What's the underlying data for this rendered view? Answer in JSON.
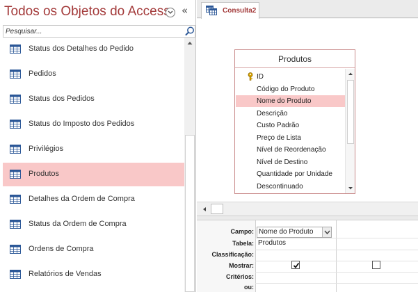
{
  "nav": {
    "title": "Todos os Objetos do Access",
    "dropdown_icon": "chevron-down-circle-icon",
    "collapse_glyph": "«",
    "search_placeholder": "Pesquisar...",
    "items": [
      {
        "label": "Status dos Detalhes do Pedido",
        "icon": "table-icon",
        "selected": false
      },
      {
        "label": "Pedidos",
        "icon": "table-icon",
        "selected": false
      },
      {
        "label": "Status dos Pedidos",
        "icon": "table-icon",
        "selected": false
      },
      {
        "label": "Status do Imposto dos Pedidos",
        "icon": "table-icon",
        "selected": false
      },
      {
        "label": "Privilégios",
        "icon": "table-icon",
        "selected": false
      },
      {
        "label": "Produtos",
        "icon": "table-icon",
        "selected": true
      },
      {
        "label": "Detalhes da Ordem de Compra",
        "icon": "table-icon",
        "selected": false
      },
      {
        "label": "Status da Ordem de Compra",
        "icon": "table-icon",
        "selected": false
      },
      {
        "label": "Ordens de Compra",
        "icon": "table-icon",
        "selected": false
      },
      {
        "label": "Relatórios de Vendas",
        "icon": "table-icon",
        "selected": false
      }
    ]
  },
  "document": {
    "tab_label": "Consulta2",
    "tab_icon": "query-icon",
    "field_list": {
      "title": "Produtos",
      "fields": [
        {
          "label": "ID",
          "primary_key": true,
          "selected": false
        },
        {
          "label": "Código do Produto",
          "primary_key": false,
          "selected": false
        },
        {
          "label": "Nome do Produto",
          "primary_key": false,
          "selected": true
        },
        {
          "label": "Descrição",
          "primary_key": false,
          "selected": false
        },
        {
          "label": "Custo Padrão",
          "primary_key": false,
          "selected": false
        },
        {
          "label": "Preço de Lista",
          "primary_key": false,
          "selected": false
        },
        {
          "label": "Nível de Reordenação",
          "primary_key": false,
          "selected": false
        },
        {
          "label": "Nível de Destino",
          "primary_key": false,
          "selected": false
        },
        {
          "label": "Quantidade por Unidade",
          "primary_key": false,
          "selected": false
        },
        {
          "label": "Descontinuado",
          "primary_key": false,
          "selected": false
        }
      ]
    },
    "grid": {
      "row_labels": [
        "Campo:",
        "Tabela:",
        "Classificação:",
        "Mostrar:",
        "Critérios:",
        "ou:"
      ],
      "columns": [
        {
          "campo": "Nome do Produto",
          "tabela": "Produtos",
          "mostrar": true
        },
        {
          "campo": "",
          "tabela": "",
          "mostrar": false
        }
      ]
    }
  },
  "colors": {
    "accent": "#a33a3a",
    "selection": "#f9c8c8"
  }
}
